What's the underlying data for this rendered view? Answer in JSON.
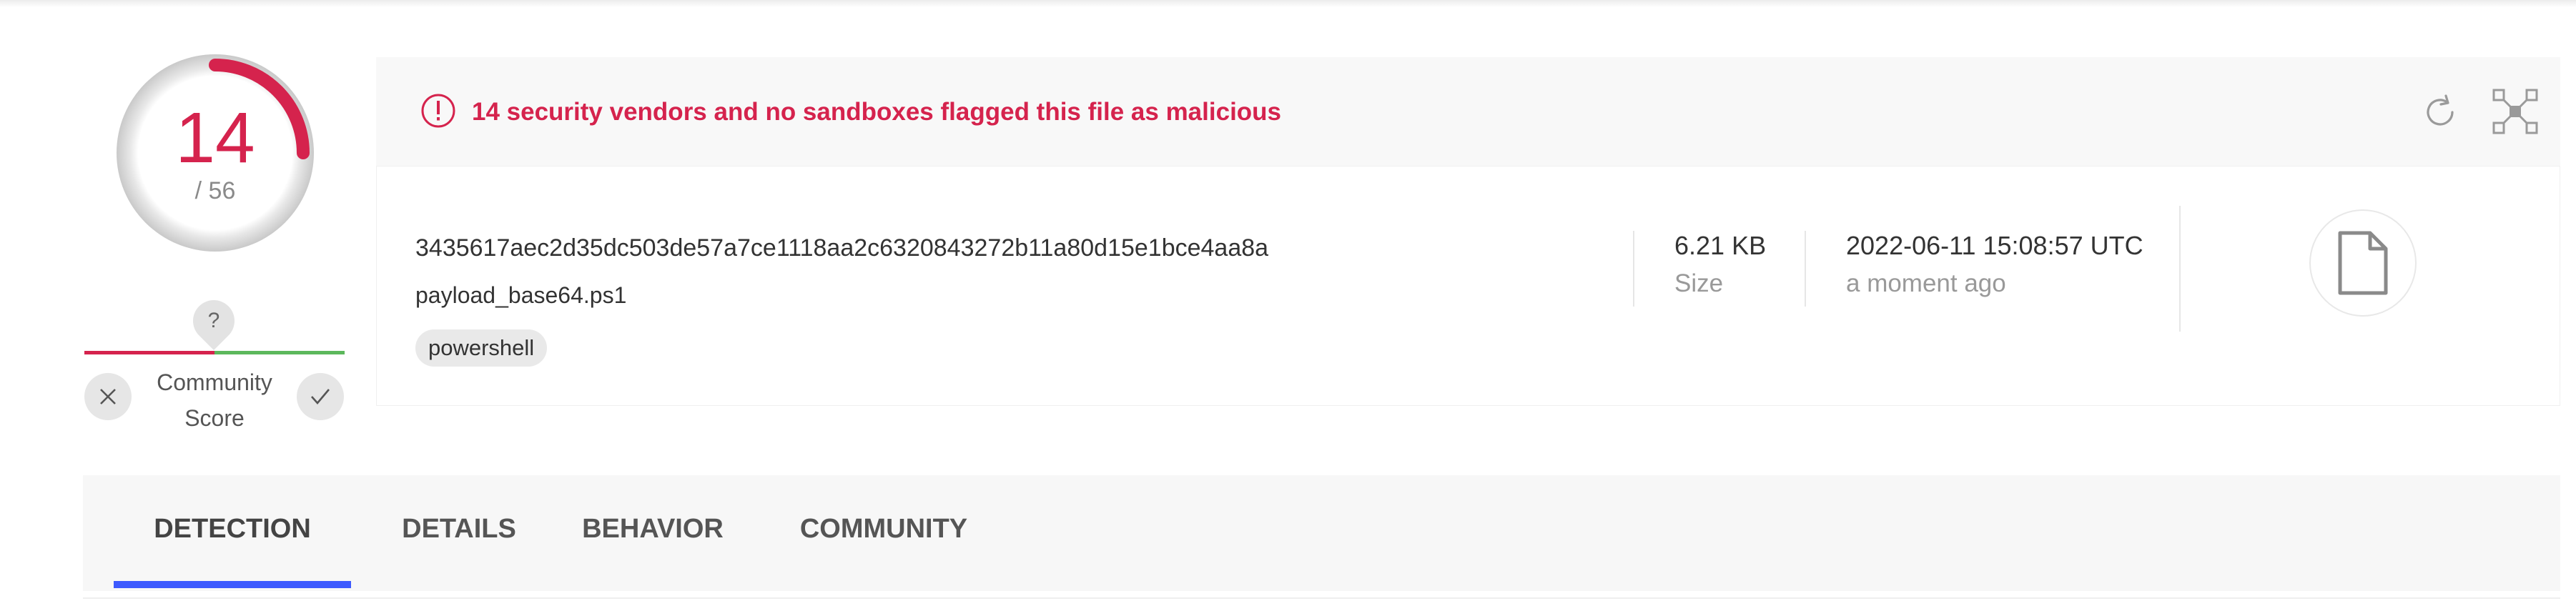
{
  "detection_score": {
    "malicious": 14,
    "total_label": "/ 56",
    "ratio": 0.25,
    "accent_color": "#d5234d"
  },
  "community": {
    "marker_glyph": "?",
    "label_line1": "Community",
    "label_line2": "Score",
    "down_icon": "x-icon",
    "up_icon": "check-icon"
  },
  "alert": {
    "text": "14 security vendors and no sandboxes flagged this file as malicious",
    "icon": "exclamation-circle-icon",
    "color": "#d5234d"
  },
  "toolbar": {
    "refresh_icon": "refresh-icon",
    "graph_icon": "graph-icon"
  },
  "file": {
    "hash": "3435617aec2d35dc503de57a7ce1118aa2c6320843272b11a80d15e1bce4aa8a",
    "name": "payload_base64.ps1",
    "tags": [
      "powershell"
    ],
    "size_value": "6.21 KB",
    "size_label": "Size",
    "date_value": "2022-06-11 15:08:57 UTC",
    "date_relative": "a moment ago",
    "type_icon": "file-icon"
  },
  "tabs": [
    {
      "label": "DETECTION",
      "active": true
    },
    {
      "label": "DETAILS",
      "active": false
    },
    {
      "label": "BEHAVIOR",
      "active": false
    },
    {
      "label": "COMMUNITY",
      "active": false
    }
  ],
  "colors": {
    "malicious": "#d5234d",
    "harmless": "#5cb85c",
    "tab_active": "#3d5afe"
  }
}
